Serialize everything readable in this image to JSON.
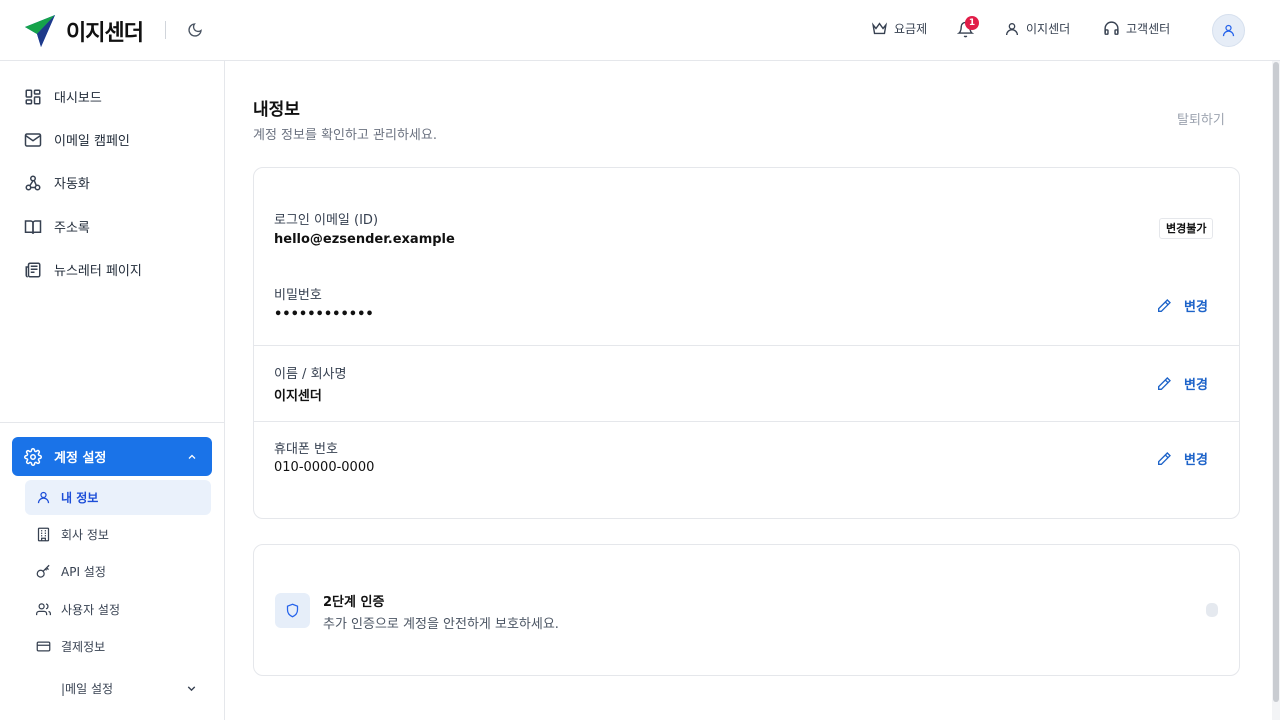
{
  "header": {
    "brand": "이지센더",
    "nav": {
      "pricing": "요금제",
      "notification_count": "1",
      "user": "이지센더",
      "support": "고객센터"
    }
  },
  "sidebar": {
    "items": [
      {
        "label": "대시보드",
        "icon": "dashboard-icon"
      },
      {
        "label": "이메일 캠페인",
        "icon": "mail-icon"
      },
      {
        "label": "자동화",
        "icon": "automation-icon"
      },
      {
        "label": "주소록",
        "icon": "book-icon"
      },
      {
        "label": "뉴스레터 페이지",
        "icon": "newspaper-icon"
      }
    ],
    "account_section": "계정 설정",
    "sub_items": [
      {
        "label": "내 정보",
        "icon": "user-icon"
      },
      {
        "label": "회사 정보",
        "icon": "building-icon"
      },
      {
        "label": "API 설정",
        "icon": "key-icon"
      },
      {
        "label": "사용자 설정",
        "icon": "users-icon"
      },
      {
        "label": "결제정보",
        "icon": "card-icon"
      }
    ],
    "mail_settings": "|메일 설정"
  },
  "main": {
    "title": "내정보",
    "subtitle": "계정 정보를 확인하고 관리하세요.",
    "withdraw": "탈퇴하기",
    "fields": {
      "email": {
        "label": "로그인 이메일 (ID)",
        "value": "hello@ezsender.example",
        "tag": "변경불가"
      },
      "password": {
        "label": "비밀번호",
        "value": "••••••••••••",
        "action": "변경"
      },
      "name": {
        "label": "이름 / 회사명",
        "value": "이지센더",
        "action": "변경"
      },
      "phone": {
        "label": "휴대폰 번호",
        "value": "010-0000-0000",
        "action": "변경"
      }
    },
    "two_factor": {
      "title": "2단계 인증",
      "description": "추가 인증으로 계정을 안전하게 보호하세요."
    }
  },
  "colors": {
    "accent": "#1a73e8",
    "link": "#1d63c9",
    "badge": "#e11d48"
  }
}
